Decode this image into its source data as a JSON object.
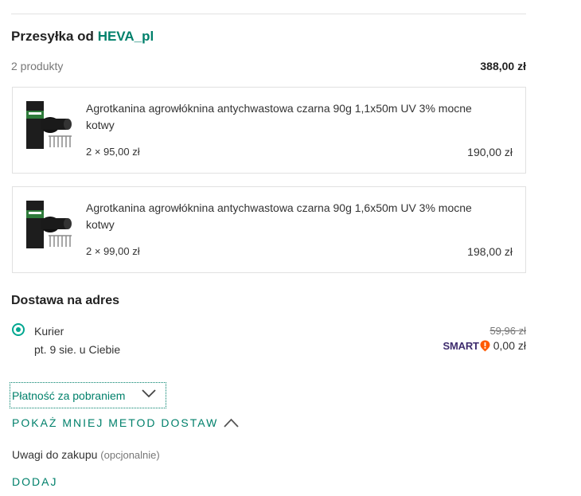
{
  "shipment": {
    "title_prefix": "Przesyłka od",
    "seller": "HEVA_pl",
    "count_label": "2 produkty",
    "total": "388,00 zł"
  },
  "products": [
    {
      "name": "Agrotkanina agrowłóknina antychwastowa czarna 90g 1,1x50m UV 3% mocne kotwy",
      "qty": "2 × 95,00 zł",
      "price": "190,00 zł"
    },
    {
      "name": "Agrotkanina agrowłóknina antychwastowa czarna 90g 1,6x50m UV 3% mocne kotwy",
      "qty": "2 × 99,00 zł",
      "price": "198,00 zł"
    }
  ],
  "delivery": {
    "title": "Dostawa na adres",
    "method": "Kurier",
    "date": "pt. 9 sie. u Ciebie",
    "old_price": "59,96 zł",
    "smart_label": "SMART",
    "new_price": "0,00 zł",
    "selected": true
  },
  "payment": {
    "selected": "Płatność za pobraniem"
  },
  "toggle": {
    "label": "POKAŻ MNIEJ METOD DOSTAW"
  },
  "notes": {
    "label": "Uwagi do zakupu",
    "optional": "(opcjonalnie)",
    "add_label": "DODAJ"
  },
  "colors": {
    "accent": "#00806b",
    "radio": "#00a790",
    "smart": "#3f2d6e",
    "smart_badge": "#ff5a00"
  }
}
